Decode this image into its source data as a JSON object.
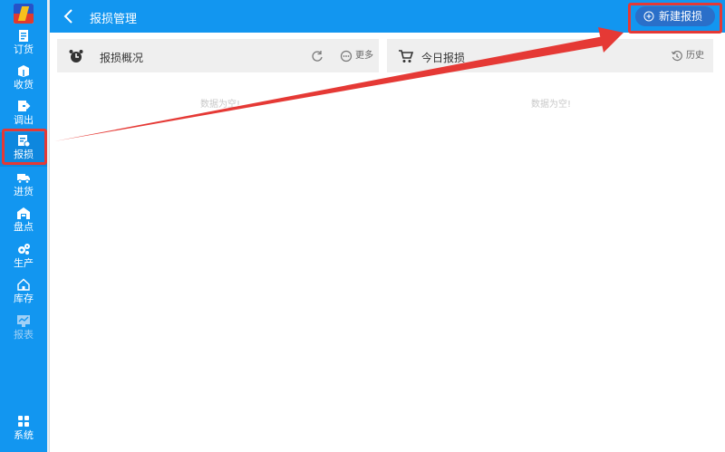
{
  "sidebar": {
    "items": [
      {
        "label": "订货",
        "icon": "clipboard-icon"
      },
      {
        "label": "收货",
        "icon": "box-icon"
      },
      {
        "label": "调出",
        "icon": "export-icon"
      },
      {
        "label": "报损",
        "icon": "damage-report-icon"
      },
      {
        "label": "进货",
        "icon": "truck-icon"
      },
      {
        "label": "盘点",
        "icon": "warehouse-icon"
      },
      {
        "label": "生产",
        "icon": "gears-icon"
      },
      {
        "label": "库存",
        "icon": "home-icon"
      },
      {
        "label": "报表",
        "icon": "chart-icon"
      },
      {
        "label": "系统",
        "icon": "grid-icon"
      }
    ],
    "active": "报损"
  },
  "header": {
    "title": "报损管理",
    "new_button_label": "新建报损"
  },
  "panels": [
    {
      "title": "报损概况",
      "icon": "alarm-clock-icon",
      "actions": [
        {
          "label": "",
          "icon": "refresh-icon"
        },
        {
          "label": "更多",
          "icon": "more-icon"
        }
      ],
      "empty_text": "数据为空!"
    },
    {
      "title": "今日报损",
      "icon": "cart-icon",
      "actions": [
        {
          "label": "历史",
          "icon": "history-icon"
        }
      ],
      "empty_text": "数据为空!"
    }
  ],
  "colors": {
    "primary": "#1296f0",
    "highlight": "#e53935",
    "button": "#2a6fc9"
  }
}
